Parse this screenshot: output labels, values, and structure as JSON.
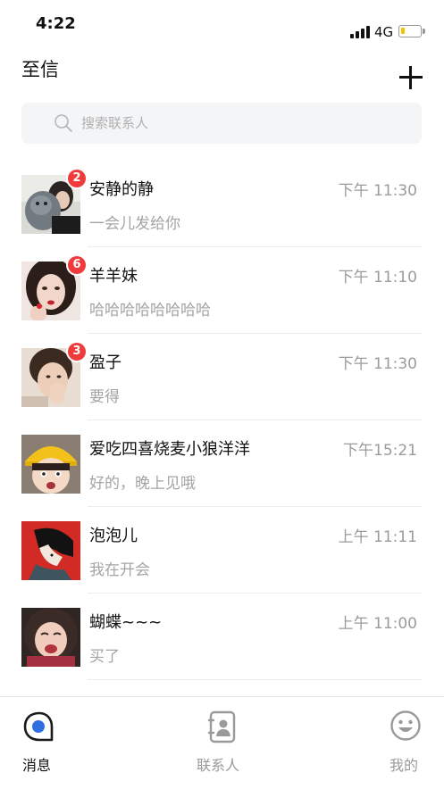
{
  "status_bar": {
    "time": "4:22",
    "network": "4G"
  },
  "header": {
    "title": "至信"
  },
  "search": {
    "placeholder": "搜索联系人"
  },
  "chats": [
    {
      "name": "安静的静",
      "time": "下午 11:30",
      "preview": "一会儿发给你",
      "badge": "2"
    },
    {
      "name": "羊羊妹",
      "time": "下午 11:10",
      "preview": "哈哈哈哈哈哈哈哈",
      "badge": "6"
    },
    {
      "name": "盈子",
      "time": "下午 11:30",
      "preview": "要得",
      "badge": "3"
    },
    {
      "name": "爱吃四喜烧麦小狼洋洋",
      "time": "下午15:21",
      "preview": "好的，晚上见哦",
      "badge": ""
    },
    {
      "name": "泡泡儿",
      "time": "上午 11:11",
      "preview": "我在开会",
      "badge": ""
    },
    {
      "name": "蝴蝶~~~",
      "time": "上午 11:00",
      "preview": "买了",
      "badge": ""
    }
  ],
  "tabs": [
    {
      "label": "消息",
      "icon": "chat-bubble-icon",
      "active": true
    },
    {
      "label": "联系人",
      "icon": "contacts-book-icon",
      "active": false
    },
    {
      "label": "我的",
      "icon": "smiley-face-icon",
      "active": false
    }
  ],
  "colors": {
    "accent": "#2f6fdf",
    "badge": "#ef3b3b",
    "battery": "#f2c200"
  }
}
